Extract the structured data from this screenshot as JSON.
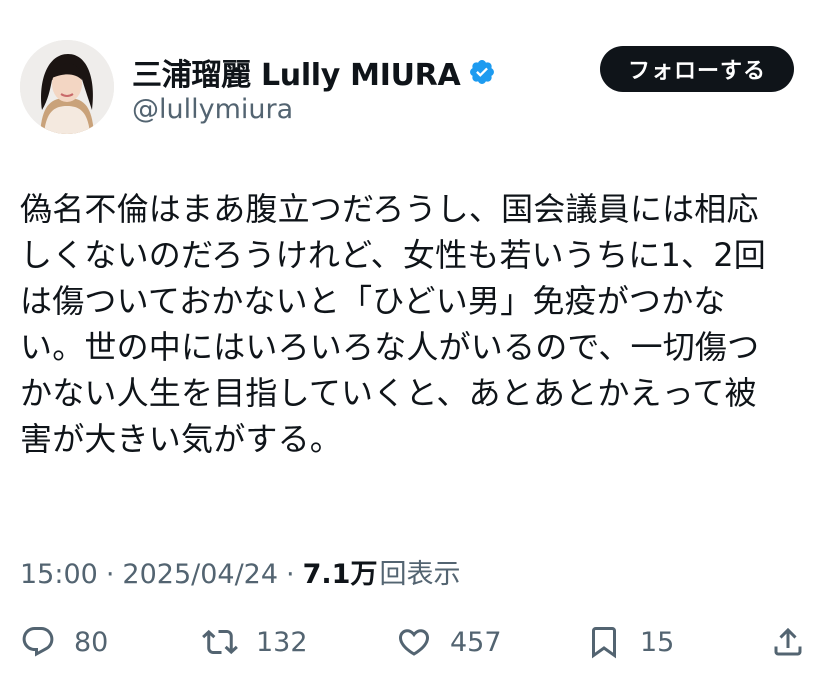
{
  "author": {
    "name": "三浦瑠麗 Lully MIURA",
    "handle": "@lullymiura",
    "follow_label": "フォローする",
    "verified_color": "#1d9bf0"
  },
  "tweet": {
    "lines": [
      "偽名不倫はまあ腹立つだろうし、国会議員には相応",
      "しくないのだろうけれど、女性も若いうちに1、2回",
      "は傷ついておかないと「ひどい男」免疫がつかな",
      "い。世の中にはいろいろな人がいるので、一切傷つ",
      "かない人生を目指していくと、あとあとかえって被",
      "害が大きい気がする。"
    ]
  },
  "meta": {
    "time": "15:00",
    "separator": "·",
    "date": "2025/04/24",
    "views_count": "7.1万",
    "views_label": "回表示"
  },
  "actions": {
    "replies": {
      "icon": "reply-icon",
      "count": "80"
    },
    "retweets": {
      "icon": "retweet-icon",
      "count": "132"
    },
    "likes": {
      "icon": "heart-icon",
      "count": "457"
    },
    "bookmarks": {
      "icon": "bookmark-icon",
      "count": "15"
    },
    "share": {
      "icon": "share-icon"
    }
  }
}
